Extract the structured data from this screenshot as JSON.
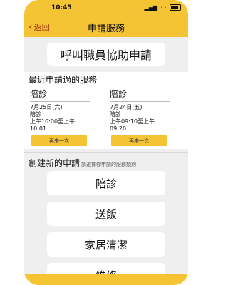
{
  "status": {
    "time": "10:45",
    "signal": "▂▄▆",
    "wifi": "◠"
  },
  "nav": {
    "back_label": "返回",
    "title": "申請服務"
  },
  "call_staff_label": "呼叫職員協助申請",
  "recent": {
    "title": "最近申請過的服務",
    "cards": [
      {
        "service": "陪診",
        "date": "7月25日(六)",
        "type": "陪診",
        "time_line1": "上午10:00至上午",
        "time_line2": "10:01",
        "again_label": "再來一次"
      },
      {
        "service": "陪診",
        "date": "7月24日(五)",
        "type": "陪診",
        "time_line1": "上午09:10至上午",
        "time_line2": "09:20",
        "again_label": "再來一次"
      }
    ]
  },
  "create": {
    "title": "創建新的申請",
    "subtitle": "請選擇你申請的服務類別",
    "categories": [
      "陪診",
      "送飯",
      "家居清潔",
      "維修"
    ]
  }
}
